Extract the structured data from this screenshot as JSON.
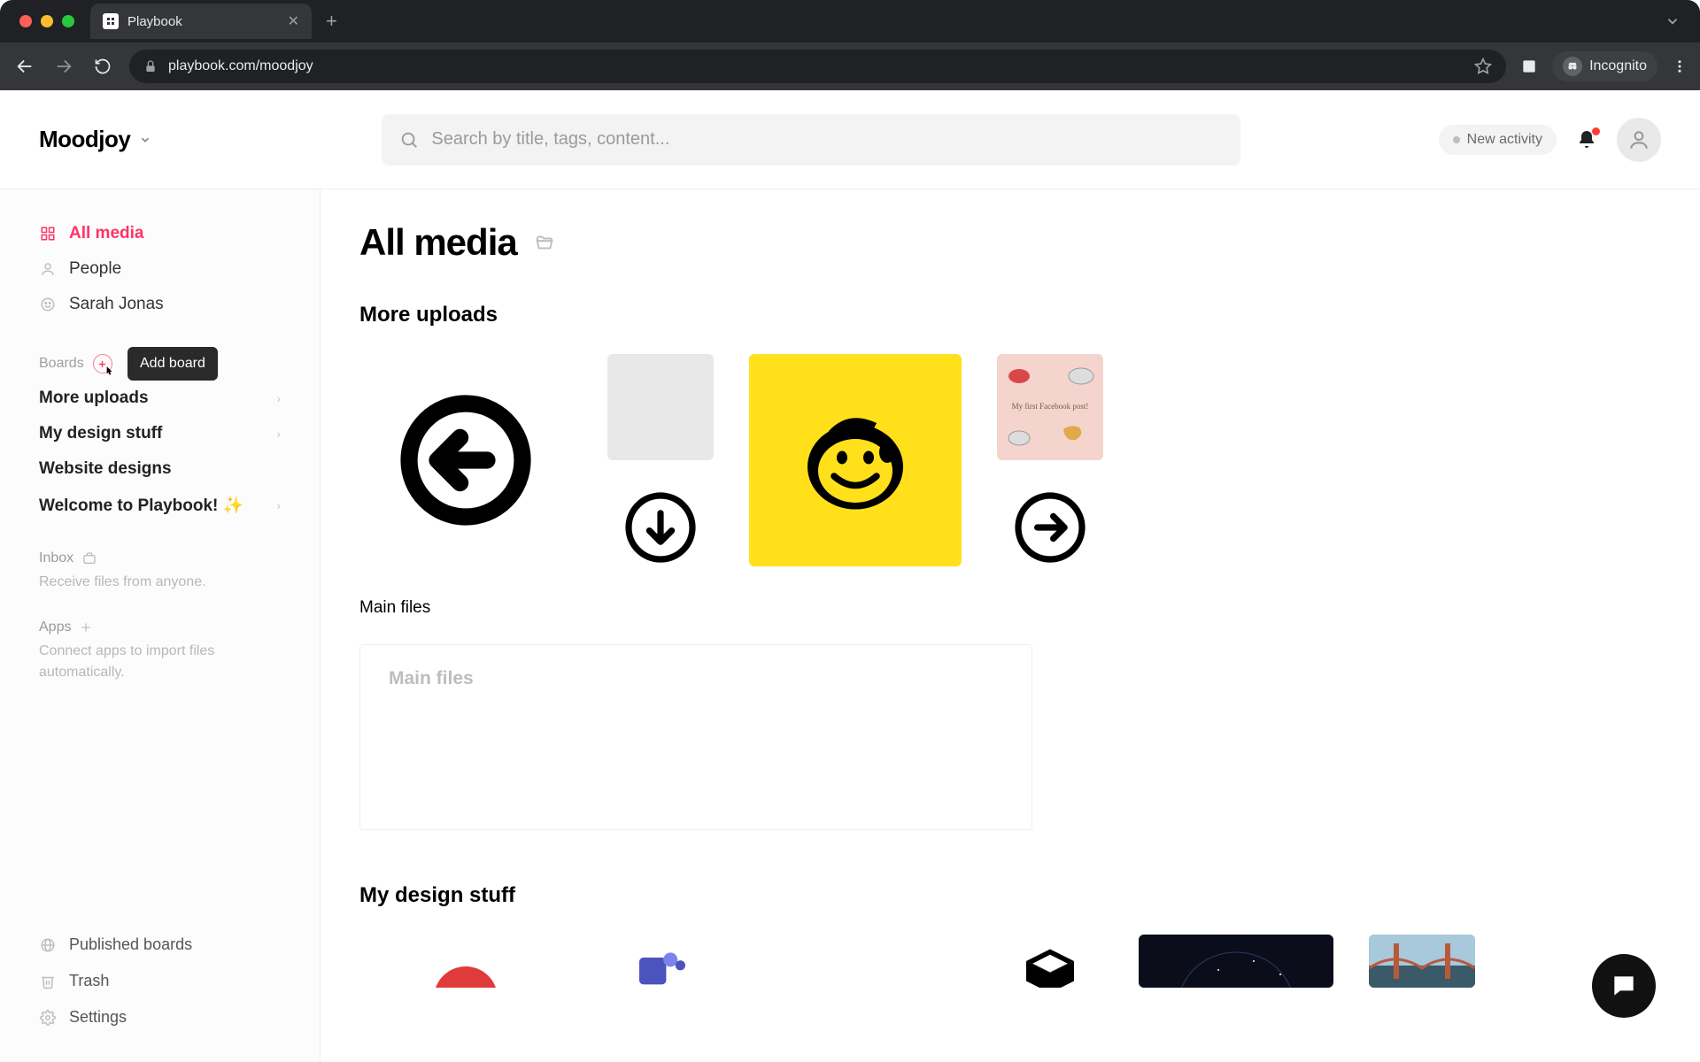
{
  "browser": {
    "tab_title": "Playbook",
    "url": "playbook.com/moodjoy",
    "mode_label": "Incognito"
  },
  "topbar": {
    "workspace": "Moodjoy",
    "search_placeholder": "Search by title, tags, content...",
    "activity_label": "New activity"
  },
  "sidebar": {
    "nav": [
      {
        "label": "All media",
        "icon": "grid",
        "active": true
      },
      {
        "label": "People",
        "icon": "person",
        "active": false
      },
      {
        "label": "Sarah Jonas",
        "icon": "smile",
        "active": false
      }
    ],
    "boards_header": "Boards",
    "add_board_tooltip": "Add board",
    "boards": [
      {
        "label": "More uploads",
        "expandable": true
      },
      {
        "label": "My design stuff",
        "expandable": true
      },
      {
        "label": "Website designs",
        "expandable": false
      },
      {
        "label": "Welcome to Playbook! ✨",
        "expandable": true
      }
    ],
    "inbox": {
      "title": "Inbox",
      "desc": "Receive files from anyone."
    },
    "apps": {
      "title": "Apps",
      "desc": "Connect apps to import files automatically."
    },
    "bottom": [
      {
        "label": "Published boards",
        "icon": "globe"
      },
      {
        "label": "Trash",
        "icon": "trash"
      },
      {
        "label": "Settings",
        "icon": "gear"
      }
    ]
  },
  "main": {
    "page_title": "All media",
    "sections": [
      {
        "title": "More uploads",
        "subboard_label": "Main files",
        "subboard_card_title": "Main files"
      },
      {
        "title": "My design stuff"
      }
    ]
  }
}
